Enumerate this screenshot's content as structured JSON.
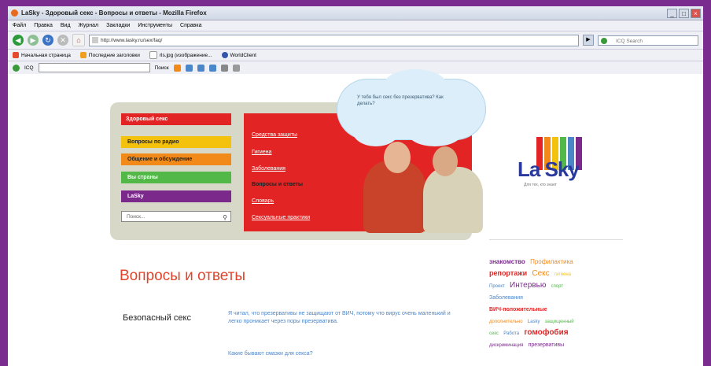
{
  "window": {
    "title": "LaSky - Здоровый секс - Вопросы и ответы - Mozilla Firefox",
    "buttons": [
      "_",
      "□",
      "×"
    ]
  },
  "menu": [
    "Файл",
    "Правка",
    "Вид",
    "Журнал",
    "Закладки",
    "Инструменты",
    "Справка"
  ],
  "nav": {
    "url": "http://www.lasky.ru/sex/faq/",
    "search_placeholder": "ICQ Search"
  },
  "bookmarks": [
    {
      "label": "Начальная страница",
      "color": "#e64a2e"
    },
    {
      "label": "Последние заголовки",
      "color": "#f0a020"
    },
    {
      "label": "rls.jpg (изображение...",
      "color": "#cccccc"
    },
    {
      "label": "WorldClient",
      "color": "#3355aa"
    }
  ],
  "toolbar2": {
    "icq_label": "ICQ",
    "find_label": "Поиск"
  },
  "site": {
    "cloud_text": "У тебя был секс без презерватива? Как делать?",
    "left_menu": {
      "header": "Здоровый секс",
      "items": [
        "Вопросы по радио",
        "Общение и обсуждение",
        "Вы страны",
        "LaSky"
      ],
      "search_placeholder": "Поиск..."
    },
    "red_menu": [
      {
        "label": "Средства защиты",
        "active": false
      },
      {
        "label": "Гигиена",
        "active": false
      },
      {
        "label": "Заболевания",
        "active": false
      },
      {
        "label": "Вопросы и ответы",
        "active": true
      },
      {
        "label": "Словарь",
        "active": false
      },
      {
        "label": "Сексуальные практики",
        "active": false
      }
    ],
    "logo": {
      "text": "La Sky",
      "subtitle": "Для тех, кто знает",
      "stripe_colors": [
        "#e32424",
        "#f28a1a",
        "#f4c20d",
        "#52b848",
        "#4b86c9",
        "#7b2a8c"
      ]
    },
    "page_title": "Вопросы и ответы",
    "question": {
      "heading": "Безопасный секс",
      "text": "Я читал, что презервативы не защищают от ВИЧ, потому что вирус очень маленький и легко проникает через поры презерватива.",
      "link": "Какие бывают смазки для секса?"
    },
    "tags": [
      {
        "text": "знакомство",
        "color": "#7b2a8c"
      },
      {
        "text": "Профилактика",
        "color": "#f28a1a"
      },
      {
        "text": "репортажи",
        "color": "#e32424"
      },
      {
        "text": "Секс",
        "color": "#f28a1a"
      },
      {
        "text": "гигиена",
        "color": "#f4c20d"
      },
      {
        "text": "Проект",
        "color": "#4b86c9"
      },
      {
        "text": "Интервью",
        "color": "#7b2a8c"
      },
      {
        "text": "спорт",
        "color": "#52b848"
      },
      {
        "text": "Заболевания",
        "color": "#4b86c9"
      },
      {
        "text": "ВИЧ-положительные",
        "color": "#e32424"
      },
      {
        "text": "дополнительно",
        "color": "#f28a1a"
      },
      {
        "text": "Lasky",
        "color": "#4b86c9"
      },
      {
        "text": "защищенный",
        "color": "#52b848"
      },
      {
        "text": "секс",
        "color": "#52b848"
      },
      {
        "text": "Работа",
        "color": "#4b86c9"
      },
      {
        "text": "гомофобия",
        "color": "#e32424"
      },
      {
        "text": "дискриминация",
        "color": "#7b2a8c"
      },
      {
        "text": "презервативы",
        "color": "#7b2a8c"
      }
    ]
  }
}
